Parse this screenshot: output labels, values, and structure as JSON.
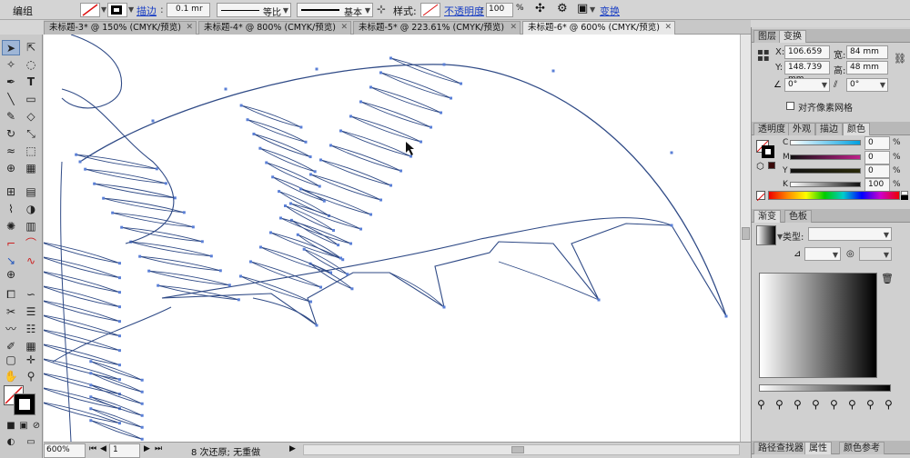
{
  "control_bar": {
    "selection_label": "编组",
    "stroke_link": "描边",
    "stroke_weight": "0.1 mr",
    "profile_label": "等比",
    "brush_label": "基本",
    "style_label": "样式:",
    "opacity_link": "不透明度",
    "opacity_value": "100",
    "opacity_unit": "%",
    "transform_link": "变换"
  },
  "tabs": [
    {
      "label": "未标题-3* @ 150% (CMYK/预览)",
      "active": false
    },
    {
      "label": "未标题-4* @ 800% (CMYK/预览)",
      "active": false
    },
    {
      "label": "未标题-5* @ 223.61% (CMYK/预览)",
      "active": false
    },
    {
      "label": "未标题-6* @ 600% (CMYK/预览)",
      "active": true
    }
  ],
  "status_bar": {
    "zoom": "600%",
    "artboard": "1",
    "message": "8 次还原; 无重做"
  },
  "transform_panel": {
    "tabs": [
      "图层",
      "变换"
    ],
    "x_label": "X:",
    "x_value": "106.659 mm",
    "y_label": "Y:",
    "y_value": "148.739 mm",
    "w_label": "宽:",
    "w_value": "84 mm",
    "h_label": "高:",
    "h_value": "48 mm",
    "angle_value": "0°",
    "shear_value": "0°",
    "pixel_grid_label": "对齐像素网格"
  },
  "color_panel": {
    "tabs": [
      "透明度",
      "外观",
      "描边",
      "颜色"
    ],
    "channels": [
      {
        "name": "C",
        "value": "0"
      },
      {
        "name": "M",
        "value": "0"
      },
      {
        "name": "Y",
        "value": "0"
      },
      {
        "name": "K",
        "value": "100"
      }
    ],
    "unit": "%"
  },
  "gradient_panel": {
    "tabs": [
      "渐变",
      "色板"
    ],
    "type_label": "类型:",
    "unit": "%"
  },
  "bottom_tabs": [
    "路径查找器",
    "属性",
    "颜色参考"
  ],
  "colors": {
    "path_stroke": "#2f4a86",
    "anchor": "#5a7fd6",
    "selection_blue": "#9fb6d6",
    "link_blue": "#1a3fc4"
  }
}
